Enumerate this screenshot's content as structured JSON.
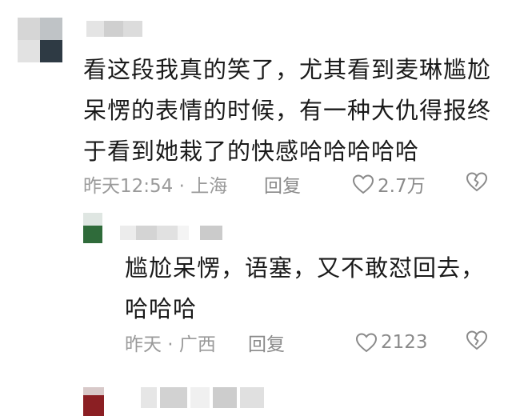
{
  "comment": {
    "text_lines": [
      "看这段我真的笑了，尤其看到麦琳尴尬",
      "呆愣的表情的时候，有一种大仇得报终",
      "于看到她栽了的快感哈哈哈哈哈"
    ],
    "time_location": "昨天12:54 · 上海",
    "reply_label": "回复",
    "like_count": "2.7万"
  },
  "reply": {
    "text_lines": [
      "尴尬呆愣，语塞，又不敢怼回去，",
      "哈哈哈"
    ],
    "time_location": "昨天 · 广西",
    "reply_label": "回复",
    "like_count": "2123"
  },
  "icons": {
    "like": "heart-outline-icon",
    "dislike": "broken-heart-icon"
  },
  "colors": {
    "text": "#1a1a1a",
    "meta": "#9a9a9a",
    "background": "#ffffff"
  }
}
